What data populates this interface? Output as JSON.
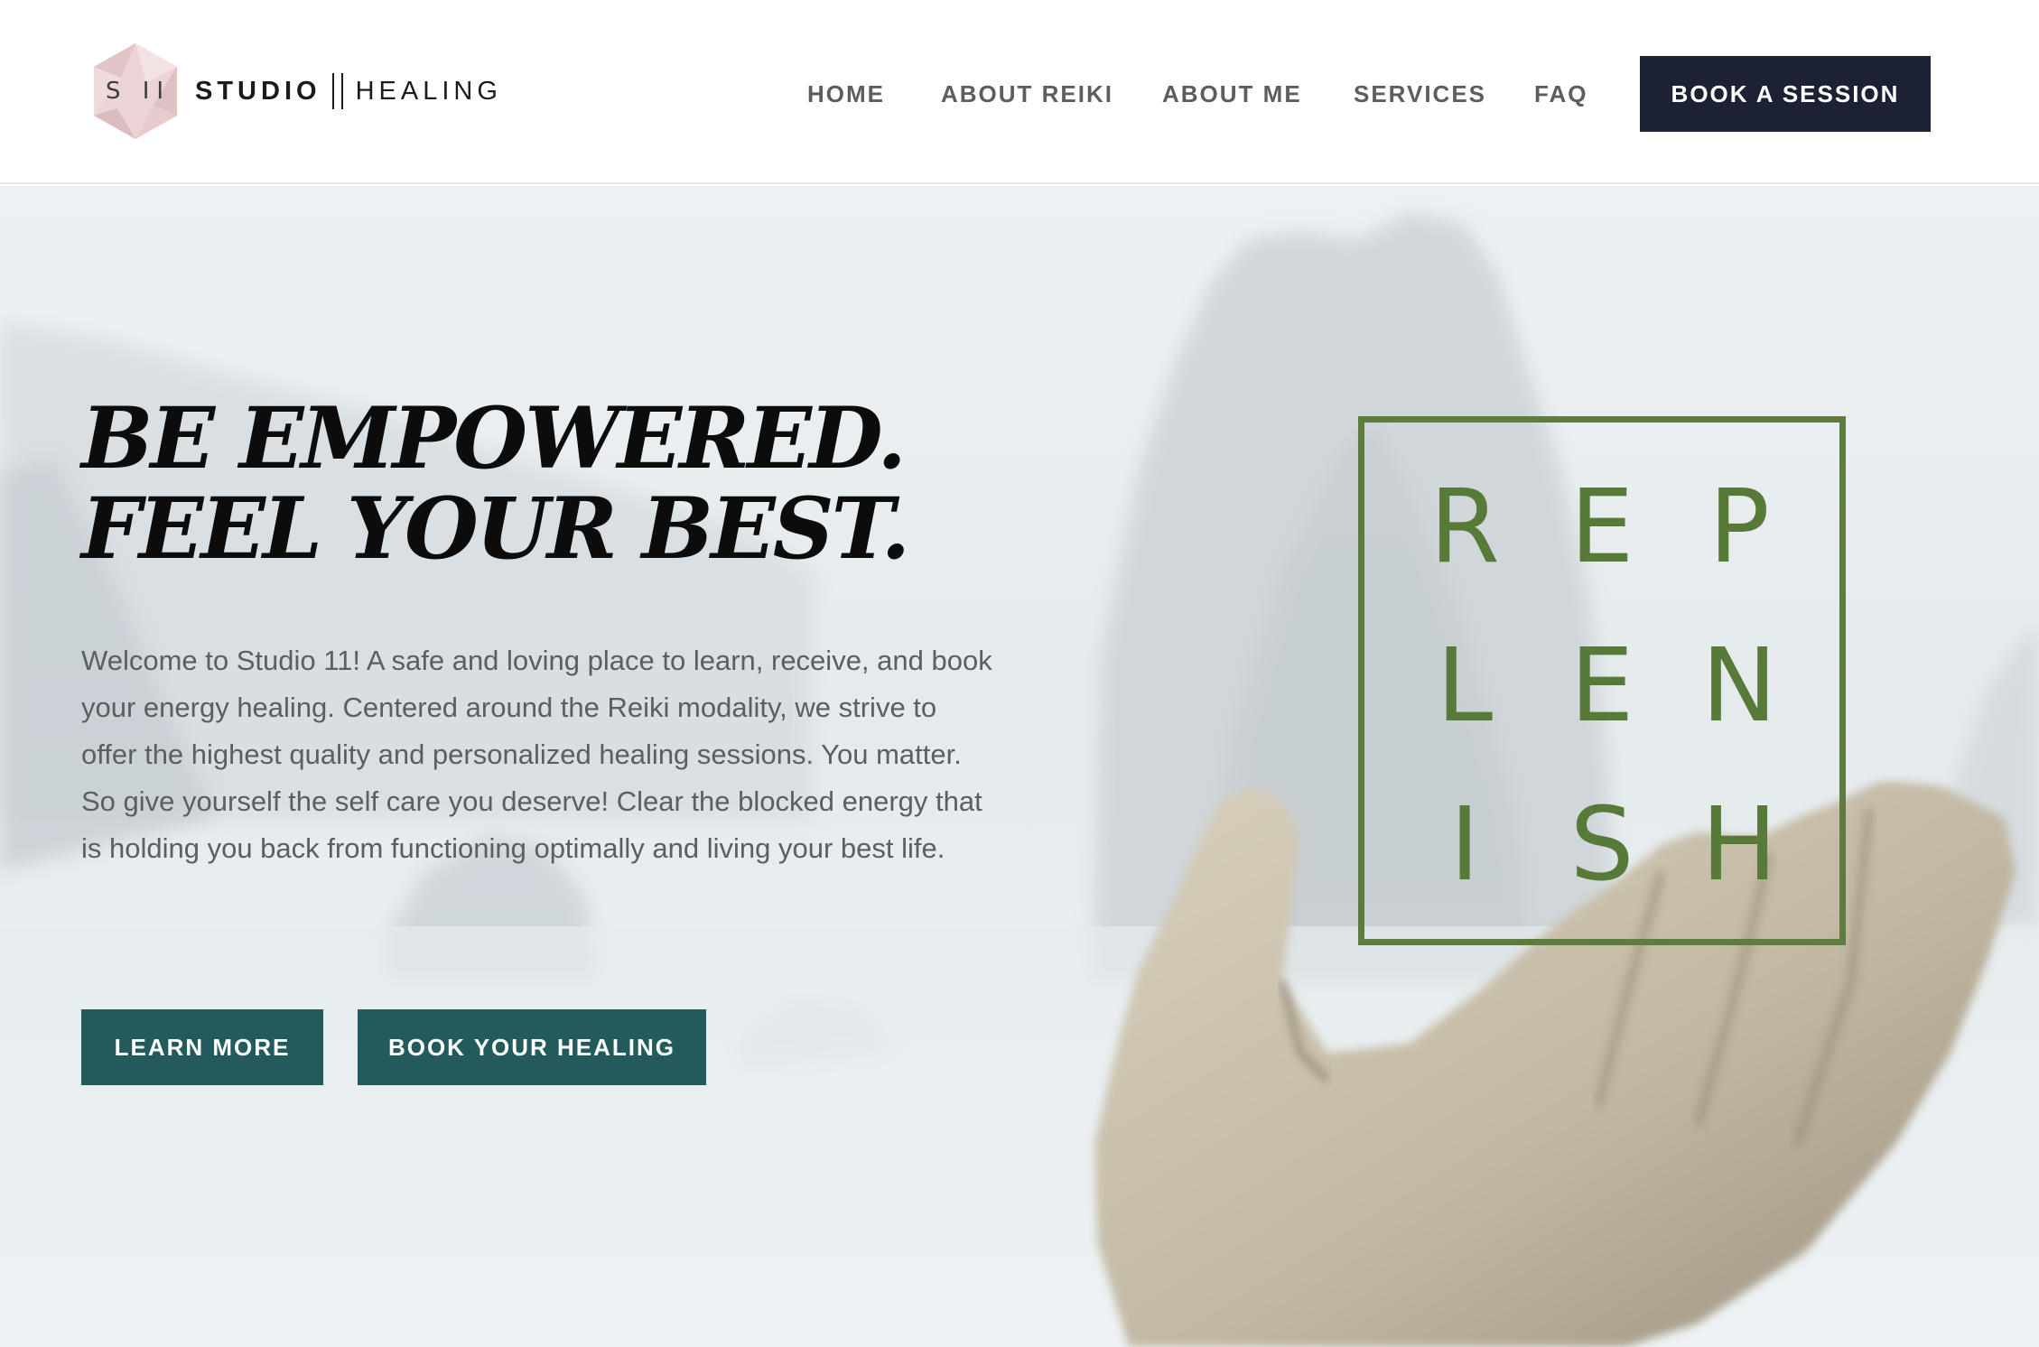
{
  "header": {
    "logo": {
      "mark_text": "S II",
      "word_1": "STUDIO",
      "word_2": "HEALING"
    },
    "nav": [
      "HOME",
      "ABOUT REIKI",
      "ABOUT ME",
      "SERVICES",
      "FAQ"
    ],
    "cta_label": "BOOK A SESSION"
  },
  "hero": {
    "heading_line_1": "BE EMPOWERED.",
    "heading_line_2": "FEEL YOUR BEST.",
    "body": "Welcome to Studio 11! A safe and loving place to learn, receive, and book your energy healing. Centered around the Reiki modality, we strive to offer the highest quality and personalized healing sessions. You matter. So give yourself the self care you deserve! Clear the blocked energy that is holding you back from functioning optimally and living your best life.",
    "buttons": {
      "learn_more": "LEARN MORE",
      "book_healing": "BOOK YOUR HEALING"
    },
    "graphic_letters": [
      "R",
      "E",
      "P",
      "L",
      "E",
      "N",
      "I",
      "S",
      "H"
    ]
  },
  "colors": {
    "header_cta": "#1c2133",
    "hero_buttons": "#235b5c",
    "graphic_green": "#5e7c40",
    "nav_text": "#5d5d5d",
    "body_text": "#5b5e62"
  }
}
